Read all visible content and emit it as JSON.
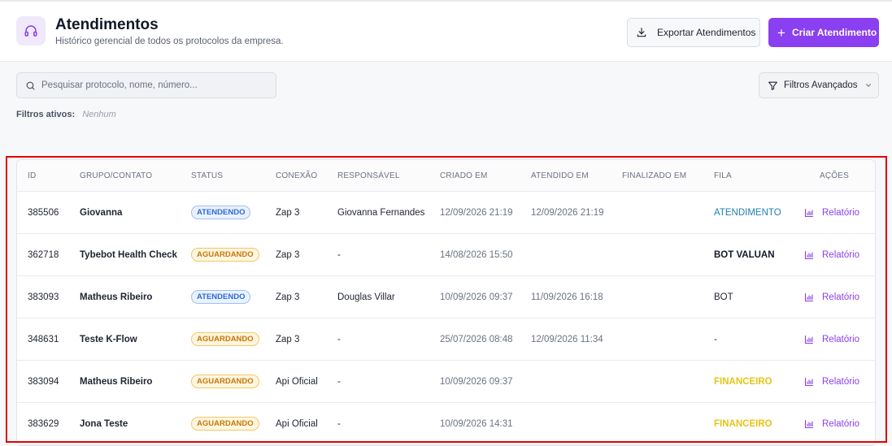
{
  "header": {
    "title": "Atendimentos",
    "subtitle": "Histórico gerencial de todos os protocolos da empresa.",
    "icon": "headset-icon",
    "export_label": "Exportar Atendimentos",
    "create_label": "Criar Atendimento",
    "accent_color": "#8a3ff0"
  },
  "search": {
    "placeholder": "Pesquisar protocolo, nome, número...",
    "value": ""
  },
  "filters": {
    "button_label": "Filtros Avançados",
    "active_label": "Filtros ativos:",
    "active_value": "Nenhum"
  },
  "table": {
    "columns": [
      "ID",
      "GRUPO/CONTATO",
      "STATUS",
      "CONEXÃO",
      "RESPONSÁVEL",
      "CRIADO EM",
      "ATENDIDO EM",
      "FINALIZADO EM",
      "FILA",
      "AÇÕES"
    ],
    "rows": [
      {
        "id": "385506",
        "contact": "Giovanna",
        "status": "ATENDENDO",
        "connection": "Zap 3",
        "responsible": "Giovanna Fernandes",
        "created": "12/09/2026 21:19",
        "attended": "12/09/2026 21:19",
        "finalized": "",
        "queue": "ATENDIMENTO",
        "action": "Relatório"
      },
      {
        "id": "362718",
        "contact": "Tybebot Health Check",
        "status": "AGUARDANDO",
        "connection": "Zap 3",
        "responsible": "-",
        "created": "14/08/2026 15:50",
        "attended": "",
        "finalized": "",
        "queue": "BOT VALUAN",
        "action": "Relatório"
      },
      {
        "id": "383093",
        "contact": "Matheus Ribeiro",
        "status": "ATENDENDO",
        "connection": "Zap 3",
        "responsible": "Douglas Villar",
        "created": "10/09/2026 09:37",
        "attended": "11/09/2026 16:18",
        "finalized": "",
        "queue": "BOT",
        "action": "Relatório"
      },
      {
        "id": "348631",
        "contact": "Teste K-Flow",
        "status": "AGUARDANDO",
        "connection": "Zap 3",
        "responsible": "-",
        "created": "25/07/2026 08:48",
        "attended": "12/09/2026 11:34",
        "finalized": "",
        "queue": "-",
        "action": "Relatório"
      },
      {
        "id": "383094",
        "contact": "Matheus Ribeiro",
        "status": "AGUARDANDO",
        "connection": "Api Oficial",
        "responsible": "-",
        "created": "10/09/2026 09:37",
        "attended": "",
        "finalized": "",
        "queue": "FINANCEIRO",
        "action": "Relatório"
      },
      {
        "id": "383629",
        "contact": "Jona Teste",
        "status": "AGUARDANDO",
        "connection": "Api Oficial",
        "responsible": "-",
        "created": "10/09/2026 14:31",
        "attended": "",
        "finalized": "",
        "queue": "FINANCEIRO",
        "action": "Relatório"
      }
    ]
  }
}
